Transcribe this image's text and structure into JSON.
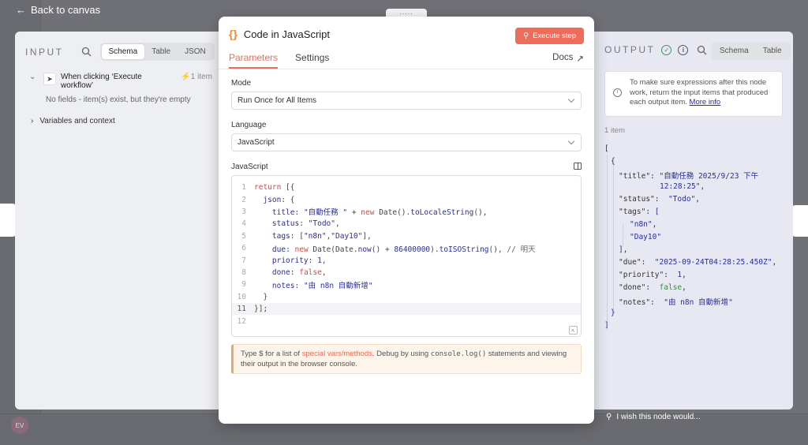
{
  "nav": {
    "back_label": "Back to canvas"
  },
  "input_panel": {
    "title": "INPUT",
    "tabs": [
      "Schema",
      "Table",
      "JSON"
    ],
    "active_tab": "Schema",
    "trigger_name": "When clicking ‘Execute workflow’",
    "trigger_count": "1 item",
    "no_fields": "No fields - item(s) exist, but they're empty",
    "variables_label": "Variables and context"
  },
  "node": {
    "title": "Code in JavaScript",
    "execute_label": "Execute step",
    "tabs": [
      "Parameters",
      "Settings"
    ],
    "active_tab": "Parameters",
    "docs_label": "Docs",
    "mode_label": "Mode",
    "mode_value": "Run Once for All Items",
    "language_label": "Language",
    "language_value": "JavaScript",
    "code_label": "JavaScript",
    "code_lines": [
      "return [{",
      "  json: {",
      "    title: \"自動任務 \" + new Date().toLocaleString(),",
      "    status: \"Todo\",",
      "    tags: [\"n8n\",\"Day10\"],",
      "    due: new Date(Date.now() + 86400000).toISOString(), // 明天",
      "    priority: 1,",
      "    done: false,",
      "    notes: \"由 n8n 自動新增\"",
      "  }",
      "}];",
      ""
    ],
    "active_line": 11,
    "hint_prefix": "Type $ for a list of",
    "hint_special": "special vars/methods",
    "hint_mid": ". Debug by using",
    "hint_code": "console.log()",
    "hint_suffix": "statements and viewing their output in the browser console."
  },
  "output_panel": {
    "title": "OUTPUT",
    "tabs": [
      "Schema",
      "Table"
    ],
    "info_text": "To make sure expressions after this node work, return the input items that produced each output item.",
    "info_link": "More info",
    "count": "1 item",
    "json_title": "自動任務 2025/9/23 下午",
    "json_title_cont": "12:28:25",
    "json_status": "Todo",
    "json_tags": [
      "n8n",
      "Day10"
    ],
    "json_due": "2025-09-24T04:28:25.450Z",
    "json_priority": "1",
    "json_done": "false",
    "json_notes": "由 n8n 自動新增"
  },
  "footer": {
    "wish_label": "I wish this node would..."
  },
  "colors": {
    "accent": "#ef6c5a",
    "code_string": "#2a2e9a",
    "success": "#3a9a5a"
  }
}
